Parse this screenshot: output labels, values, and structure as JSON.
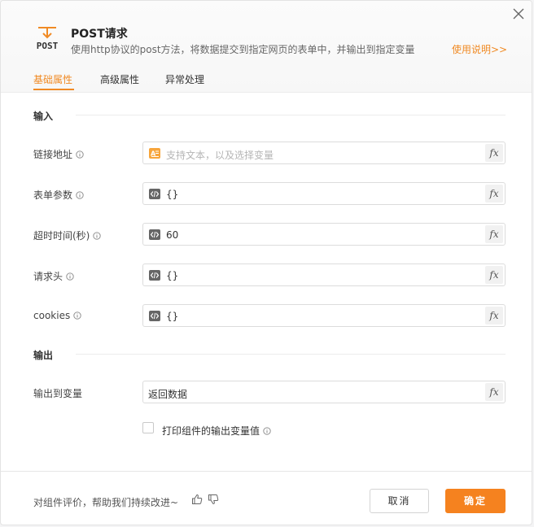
{
  "header": {
    "logo_text": "POST",
    "title": "POST请求",
    "subtitle": "使用http协议的post方法，将数据提交到指定网页的表单中，并输出到指定变量",
    "help_link": "使用说明>>"
  },
  "tabs": [
    {
      "label": "基础属性",
      "active": true
    },
    {
      "label": "高级属性",
      "active": false
    },
    {
      "label": "异常处理",
      "active": false
    }
  ],
  "sections": {
    "input_title": "输入",
    "output_title": "输出"
  },
  "fields": {
    "url": {
      "label": "链接地址",
      "placeholder": "支持文本，以及选择变量"
    },
    "form_params": {
      "label": "表单参数",
      "value": "{}"
    },
    "timeout": {
      "label": "超时时间(秒)",
      "value": "60"
    },
    "headers": {
      "label": "请求头",
      "value": "{}"
    },
    "cookies": {
      "label": "cookies",
      "value": "{}"
    },
    "output_var": {
      "label": "输出到变量",
      "value": "返回数据"
    }
  },
  "fx_label": "fx",
  "print_checkbox": {
    "label": "打印组件的输出变量值",
    "checked": false
  },
  "footer": {
    "feedback": "对组件评价，帮助我们持续改进~",
    "cancel": "取消",
    "confirm": "确定"
  },
  "colors": {
    "accent": "#f08a24",
    "primary_button": "#f5821f"
  }
}
